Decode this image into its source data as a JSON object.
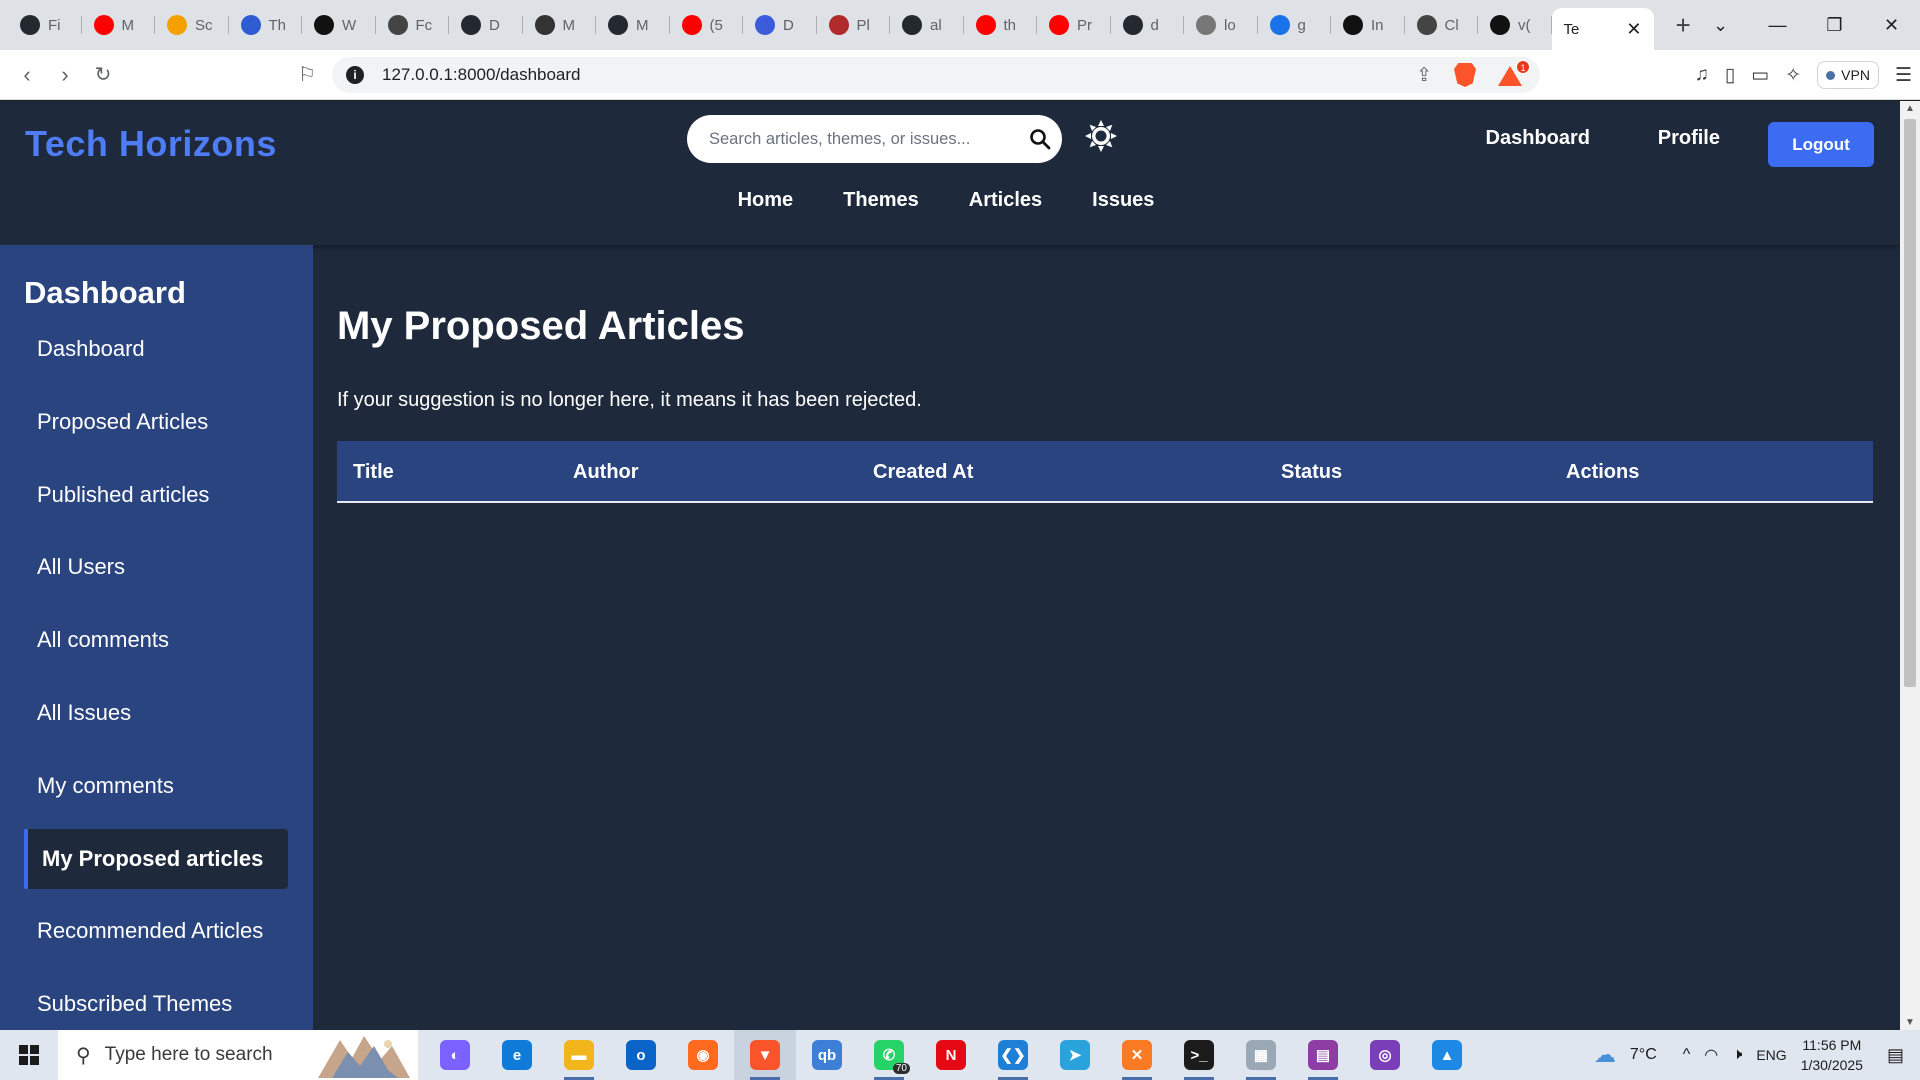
{
  "browser": {
    "tabs": [
      {
        "label": "Fi",
        "icon": "github-icon",
        "color": "#24292f"
      },
      {
        "label": "M",
        "icon": "youtube-icon",
        "color": "#ff0000"
      },
      {
        "label": "Sc",
        "icon": "scholar-icon",
        "color": "#f4a100"
      },
      {
        "label": "Th",
        "icon": "power-icon",
        "color": "#2f5bd3"
      },
      {
        "label": "W",
        "icon": "medium-icon",
        "color": "#111111"
      },
      {
        "label": "Fc",
        "icon": "openai-icon",
        "color": "#444444"
      },
      {
        "label": "D",
        "icon": "github-icon",
        "color": "#24292f"
      },
      {
        "label": "M",
        "icon": "user-card-icon",
        "color": "#333333"
      },
      {
        "label": "M",
        "icon": "github-icon",
        "color": "#24292f"
      },
      {
        "label": "(5",
        "icon": "youtube-icon",
        "color": "#ff0000"
      },
      {
        "label": "D",
        "icon": "dribbble-icon",
        "color": "#3b5bdb"
      },
      {
        "label": "Pl",
        "icon": "plane-icon",
        "color": "#b22b2b"
      },
      {
        "label": "al",
        "icon": "github-icon",
        "color": "#24292f"
      },
      {
        "label": "th",
        "icon": "youtube-icon",
        "color": "#ff0000"
      },
      {
        "label": "Pr",
        "icon": "youtube-icon",
        "color": "#ff0000"
      },
      {
        "label": "d",
        "icon": "github-icon",
        "color": "#24292f"
      },
      {
        "label": "lo",
        "icon": "mountain-icon",
        "color": "#777777"
      },
      {
        "label": "g",
        "icon": "w-icon",
        "color": "#1a73e8"
      },
      {
        "label": "In",
        "icon": "openai-icon",
        "color": "#111111"
      },
      {
        "label": "Cl",
        "icon": "openai-icon",
        "color": "#444444"
      },
      {
        "label": "v(",
        "icon": "vercel-icon",
        "color": "#111111"
      }
    ],
    "active_tab": {
      "label": "Te"
    },
    "new_tab_label": "+",
    "url": "127.0.0.1:8000/dashboard",
    "vpn_label": "VPN",
    "notification_count": "1"
  },
  "site": {
    "logo": "Tech Horizons",
    "search_placeholder": "Search articles, themes, or issues...",
    "nav": {
      "home": "Home",
      "themes": "Themes",
      "articles": "Articles",
      "issues": "Issues"
    },
    "right_nav": {
      "dashboard": "Dashboard",
      "profile": "Profile",
      "logout": "Logout"
    },
    "colors": {
      "background": "#1e293b",
      "sidebar": "#2a4480",
      "accent": "#3b6cf2",
      "logo": "#4f7cf7"
    }
  },
  "sidebar": {
    "title": "Dashboard",
    "items": [
      {
        "label": "Dashboard",
        "active": false
      },
      {
        "label": "Proposed Articles",
        "active": false
      },
      {
        "label": "Published articles",
        "active": false
      },
      {
        "label": "All Users",
        "active": false
      },
      {
        "label": "All comments",
        "active": false
      },
      {
        "label": "All Issues",
        "active": false
      },
      {
        "label": "My comments",
        "active": false
      },
      {
        "label": "My Proposed articles",
        "active": true
      },
      {
        "label": "Recommended Articles",
        "active": false
      },
      {
        "label": "Subscribed Themes",
        "active": false
      }
    ]
  },
  "main": {
    "title": "My Proposed Articles",
    "notice": "If your suggestion is no longer here, it means it has been rejected.",
    "table": {
      "columns": [
        "Title",
        "Author",
        "Created At",
        "Status",
        "Actions"
      ],
      "rows": []
    }
  },
  "taskbar": {
    "search_placeholder": "Type here to search",
    "apps": [
      {
        "name": "copilot-icon",
        "color": "#7b61ff",
        "glyph": "◐"
      },
      {
        "name": "edge-icon",
        "color": "#0f7bd8",
        "glyph": "e"
      },
      {
        "name": "file-explorer-icon",
        "color": "#f2b51b",
        "glyph": "▬"
      },
      {
        "name": "outlook-icon",
        "color": "#0a64c8",
        "glyph": "o"
      },
      {
        "name": "firefox-icon",
        "color": "#ff6a1f",
        "glyph": "◉"
      },
      {
        "name": "brave-icon",
        "color": "#fb542b",
        "glyph": "▼"
      },
      {
        "name": "qbittorrent-icon",
        "color": "#3d7fd6",
        "glyph": "qb"
      },
      {
        "name": "whatsapp-icon",
        "color": "#25d366",
        "glyph": "✆"
      },
      {
        "name": "netflix-icon",
        "color": "#e50914",
        "glyph": "N"
      },
      {
        "name": "vscode-icon",
        "color": "#1e7fd6",
        "glyph": "❮❯"
      },
      {
        "name": "telegram-icon",
        "color": "#2aa3dc",
        "glyph": "➤"
      },
      {
        "name": "xampp-icon",
        "color": "#fb7a24",
        "glyph": "✕"
      },
      {
        "name": "terminal-icon",
        "color": "#1b1b1b",
        "glyph": ">_"
      },
      {
        "name": "photos-icon",
        "color": "#9aa7b4",
        "glyph": "▦"
      },
      {
        "name": "winrar-icon",
        "color": "#8e3ea3",
        "glyph": "▤"
      },
      {
        "name": "github-desktop-icon",
        "color": "#7a3fb8",
        "glyph": "◎"
      },
      {
        "name": "image-viewer-icon",
        "color": "#1e88e5",
        "glyph": "▲"
      }
    ],
    "whatsapp_count": "70",
    "weather": "7°C",
    "language": "ENG",
    "time": "11:56 PM",
    "date": "1/30/2025"
  }
}
